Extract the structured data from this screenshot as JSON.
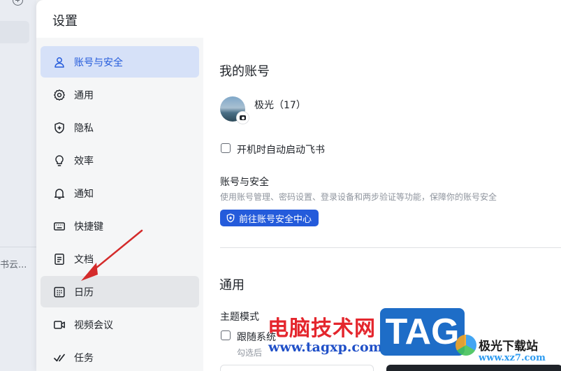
{
  "background": {
    "side_text": "书云..."
  },
  "dialog": {
    "title": "设置"
  },
  "nav": {
    "items": [
      {
        "label": "账号与安全",
        "icon": "user-icon",
        "state": "active"
      },
      {
        "label": "通用",
        "icon": "gear-icon",
        "state": "normal"
      },
      {
        "label": "隐私",
        "icon": "shield-icon",
        "state": "normal"
      },
      {
        "label": "效率",
        "icon": "lightbulb-icon",
        "state": "normal"
      },
      {
        "label": "通知",
        "icon": "bell-icon",
        "state": "normal"
      },
      {
        "label": "快捷键",
        "icon": "keyboard-icon",
        "state": "normal"
      },
      {
        "label": "文档",
        "icon": "document-icon",
        "state": "normal"
      },
      {
        "label": "日历",
        "icon": "calendar-icon",
        "state": "hover"
      },
      {
        "label": "视频会议",
        "icon": "video-icon",
        "state": "normal"
      },
      {
        "label": "任务",
        "icon": "task-check-icon",
        "state": "normal"
      }
    ]
  },
  "account": {
    "section_title": "我的账号",
    "username": "极光（17）",
    "autostart_label": "开机时自动启动飞书",
    "autostart_checked": false,
    "security_title": "账号与安全",
    "security_desc": "使用账号管理、密码设置、登录设备和两步验证等功能，保障你的账号安全",
    "security_button": "前往账号安全中心"
  },
  "general": {
    "section_title": "通用",
    "theme_title": "主题模式",
    "follow_system_label": "跟随系统",
    "follow_system_checked": false,
    "follow_system_desc": "勾选后"
  },
  "watermark": {
    "title": "电脑技术网",
    "url": "www.tagxp.com",
    "tag": "TAG",
    "site": "极光下载站",
    "site_url": "www.xz7.com"
  },
  "colors": {
    "accent": "#245bdb",
    "active_nav_bg": "#d6e1f8",
    "annotation_arrow": "#d42b2b"
  }
}
